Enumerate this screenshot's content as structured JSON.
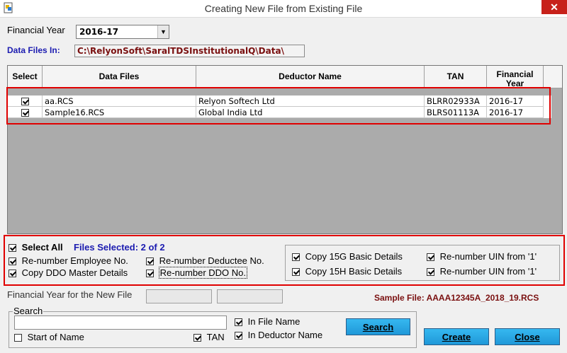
{
  "window": {
    "title": "Creating New File from Existing File",
    "close_glyph": "✕"
  },
  "financial_year": {
    "label": "Financial Year",
    "selected": "2016-17"
  },
  "data_files": {
    "label": "Data Files In:",
    "path": "C:\\RelyonSoft\\SaralTDSInstitutionalQ\\Data\\"
  },
  "grid": {
    "columns": [
      "Select",
      "Data Files",
      "Deductor Name",
      "TAN",
      "Financial Year"
    ],
    "rows": [
      {
        "selected": true,
        "file": "aa.RCS",
        "deductor": "Relyon Softech Ltd",
        "tan": "BLRR02933A",
        "fy": "2016-17"
      },
      {
        "selected": true,
        "file": "Sample16.RCS",
        "deductor": "Global India Ltd",
        "tan": "BLRS01113A",
        "fy": "2016-17"
      }
    ]
  },
  "options": {
    "select_all": "Select All",
    "files_selected": "Files Selected: 2 of 2",
    "renumber_employee": "Re-number Employee No.",
    "renumber_deductee": "Re-number Deductee No.",
    "copy_ddo_master": "Copy DDO Master Details",
    "renumber_ddo": "Re-number DDO No.",
    "copy_15g": "Copy 15G Basic Details",
    "renumber_uin_1": "Re-number UIN from '1'",
    "copy_15h": "Copy 15H Basic Details",
    "renumber_uin_2": "Re-number UIN from '1'"
  },
  "new_file": {
    "fy_label": "Financial Year for the New File",
    "sample_file": "Sample File: AAAA12345A_2018_19.RCS"
  },
  "search": {
    "group_label": "Search",
    "value": "",
    "start_of_name": "Start of Name",
    "tan": "TAN",
    "in_file_name": "In File Name",
    "in_deductor_name": "In Deductor Name",
    "search_button": "Search"
  },
  "buttons": {
    "create": "Create",
    "close": "Close"
  },
  "colors": {
    "accent_blue": "#1b1bb0",
    "path_red": "#7a1010",
    "highlight_red": "#e00000",
    "button_blue": "#2aa8e8"
  }
}
